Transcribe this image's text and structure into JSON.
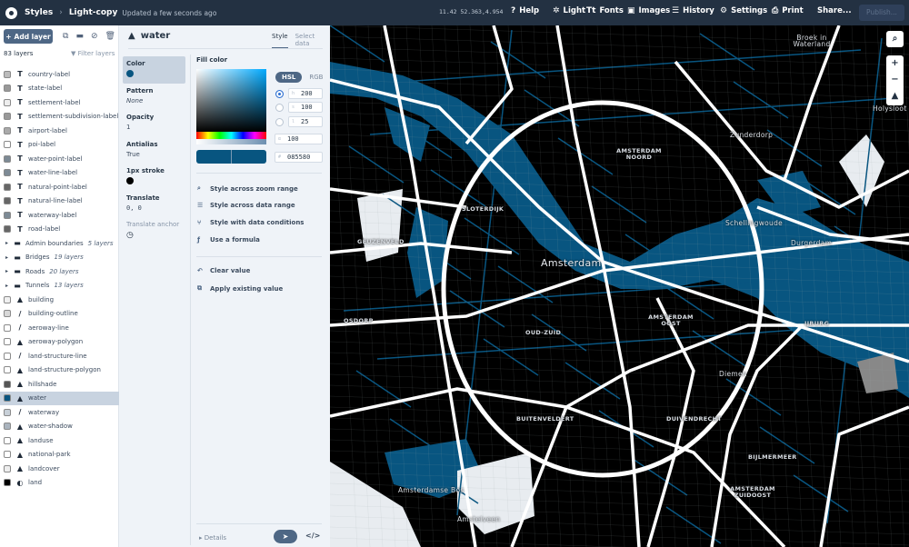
{
  "topbar": {
    "styles": "Styles",
    "style_name": "Light-copy",
    "updated": "Updated a few seconds ago",
    "coords": "11.42 52.363,4.954",
    "nav": [
      {
        "icon": "help-icon",
        "glyph": "?",
        "label": "Help"
      },
      {
        "icon": "sun-icon",
        "glyph": "✲",
        "label": "Light"
      },
      {
        "icon": "fonts-icon",
        "glyph": "Tt",
        "label": "Fonts"
      },
      {
        "icon": "images-icon",
        "glyph": "▣",
        "label": "Images"
      },
      {
        "icon": "history-icon",
        "glyph": "☰",
        "label": "History"
      },
      {
        "icon": "gear-icon",
        "glyph": "⚙",
        "label": "Settings"
      },
      {
        "icon": "print-icon",
        "glyph": "⎙",
        "label": "Print"
      },
      {
        "icon": "",
        "glyph": "",
        "label": "Share..."
      }
    ],
    "publish": "Publish..."
  },
  "layers_panel": {
    "add_layer": "Add layer",
    "count": "83 layers",
    "filter": "Filter layers",
    "layers": [
      {
        "name": "country-label",
        "type": "symbol",
        "swatch": "#bbbbbb"
      },
      {
        "name": "state-label",
        "type": "symbol",
        "swatch": "#999999"
      },
      {
        "name": "settlement-label",
        "type": "symbol",
        "swatch": "#eeeeee"
      },
      {
        "name": "settlement-subdivision-label",
        "type": "symbol",
        "swatch": "#999999"
      },
      {
        "name": "airport-label",
        "type": "symbol",
        "swatch": "#aaaaaa"
      },
      {
        "name": "poi-label",
        "type": "symbol",
        "swatch": "#ffffff"
      },
      {
        "name": "water-point-label",
        "type": "symbol",
        "swatch": "#7d8a95"
      },
      {
        "name": "water-line-label",
        "type": "symbol",
        "swatch": "#7d8a95"
      },
      {
        "name": "natural-point-label",
        "type": "symbol",
        "swatch": "#666666"
      },
      {
        "name": "natural-line-label",
        "type": "symbol",
        "swatch": "#666666"
      },
      {
        "name": "waterway-label",
        "type": "symbol",
        "swatch": "#7d8a95"
      },
      {
        "name": "road-label",
        "type": "symbol",
        "swatch": "#666666"
      },
      {
        "name": "Admin boundaries",
        "type": "group",
        "sub": "5 layers"
      },
      {
        "name": "Bridges",
        "type": "group",
        "sub": "19 layers"
      },
      {
        "name": "Roads",
        "type": "group",
        "sub": "20 layers"
      },
      {
        "name": "Tunnels",
        "type": "group",
        "sub": "13 layers"
      },
      {
        "name": "building",
        "type": "fill",
        "swatch": "#f0f0f0"
      },
      {
        "name": "building-outline",
        "type": "line",
        "swatch": "#d8d8d8"
      },
      {
        "name": "aeroway-line",
        "type": "line",
        "swatch": "#ffffff"
      },
      {
        "name": "aeroway-polygon",
        "type": "fill",
        "swatch": "#ffffff"
      },
      {
        "name": "land-structure-line",
        "type": "line",
        "swatch": "#ffffff"
      },
      {
        "name": "land-structure-polygon",
        "type": "fill",
        "swatch": "#ffffff"
      },
      {
        "name": "hillshade",
        "type": "fill",
        "swatch": "#555555"
      },
      {
        "name": "water",
        "type": "fill",
        "swatch": "#085580",
        "selected": true
      },
      {
        "name": "waterway",
        "type": "line",
        "swatch": "#c8d0d8"
      },
      {
        "name": "water-shadow",
        "type": "fill",
        "swatch": "#aab4be"
      },
      {
        "name": "landuse",
        "type": "fill",
        "swatch": "#ffffff"
      },
      {
        "name": "national-park",
        "type": "fill",
        "swatch": "#ffffff"
      },
      {
        "name": "landcover",
        "type": "fill",
        "swatch": "#eeeeee"
      },
      {
        "name": "land",
        "type": "background",
        "swatch": "#000000"
      }
    ]
  },
  "editor": {
    "layer_name": "water",
    "tabs": [
      "Style",
      "Select data"
    ],
    "properties": [
      {
        "label": "Color",
        "value": "",
        "swatch": "#085580"
      },
      {
        "label": "Pattern",
        "value": "None",
        "italic": true
      },
      {
        "label": "Opacity",
        "value": "1"
      },
      {
        "label": "Antialias",
        "value": "True"
      },
      {
        "label": "1px stroke",
        "value": "",
        "swatch": "#000000"
      },
      {
        "label": "Translate",
        "value": "0, 0",
        "mono": true
      },
      {
        "label": "Translate anchor",
        "value": ""
      }
    ],
    "fill_color": "Fill color",
    "modes": [
      "HSL",
      "RGB"
    ],
    "h": "200",
    "s": "100",
    "l": "25",
    "alpha": "100",
    "hex": "085580",
    "actions": [
      "Style across zoom range",
      "Style across data range",
      "Style with data conditions",
      "Use a formula"
    ],
    "value_actions": [
      "Clear value",
      "Apply existing value"
    ],
    "details": "Details"
  },
  "map": {
    "colors": {
      "land": "#000000",
      "water": "#085580",
      "road": "#ffffff",
      "park": "#e8ecf0"
    },
    "labels": [
      {
        "text": "Amsterdam",
        "cls": "big"
      },
      {
        "text": "AMSTERDAM NOORD"
      },
      {
        "text": "Zunderdorp",
        "cls": "pl"
      },
      {
        "text": "Schellingwoude",
        "cls": "pl"
      },
      {
        "text": "Durgerdam",
        "cls": "pl"
      },
      {
        "text": "SLOTERDIJK"
      },
      {
        "text": "GEUZENVELD"
      },
      {
        "text": "OSDORP"
      },
      {
        "text": "OUD-ZUID"
      },
      {
        "text": "AMSTERDAM OOST"
      },
      {
        "text": "IJBURG"
      },
      {
        "text": "Diemen",
        "cls": "pl"
      },
      {
        "text": "BIJLMERMEER"
      },
      {
        "text": "AMSTERDAM ZUIDOOST"
      },
      {
        "text": "DUIVENDRECHT"
      },
      {
        "text": "BUITENVELDERT"
      },
      {
        "text": "Amsterdamse Bos",
        "cls": "pl"
      },
      {
        "text": "Amstelveen",
        "cls": "pl"
      },
      {
        "text": "Broek in Waterland",
        "cls": "pl"
      },
      {
        "text": "Holysloot",
        "cls": "pl"
      }
    ],
    "controls": [
      "search-icon",
      "zoom-in",
      "zoom-out",
      "compass"
    ]
  }
}
